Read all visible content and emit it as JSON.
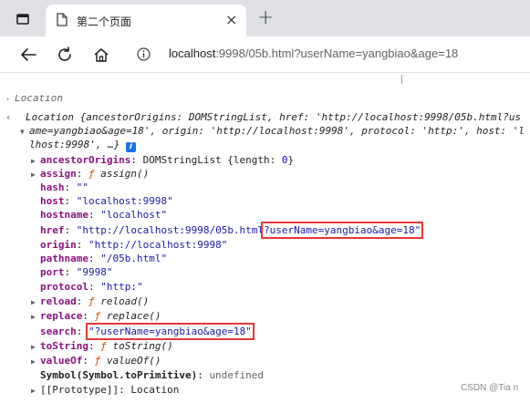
{
  "browser": {
    "tab_title": "第二个页面",
    "tab_close": "×",
    "new_tab": "+",
    "address_host": "localhost",
    "address_rest": ":9998/05b.html?userName=yangbiao&age=18"
  },
  "console": {
    "cut_line": "Location",
    "summary_prefix": "Location {",
    "summary_wrap_1": "ancestorOrigins: DOMStringList, href: 'http://localhost:9998/05b.html?us",
    "summary_wrap_2": "ame=yangbiao&age=18', origin: 'http://localhost:9998', protocol: 'http:', host: 'l",
    "summary_wrap_3": "lhost:9998', …}",
    "info": "i",
    "props": [
      {
        "key": "ancestorOrigins",
        "sep": ": ",
        "val": "DOMStringList {length: ",
        "num": "0",
        "tail": "}"
      },
      {
        "key": "assign",
        "sep": ": ",
        "f": "ƒ",
        "val": "assign()"
      },
      {
        "key": "hash",
        "sep": ": ",
        "val": "\"\""
      },
      {
        "key": "host",
        "sep": ": ",
        "val": "\"localhost:9998\""
      },
      {
        "key": "hostname",
        "sep": ": ",
        "val": "\"localhost\""
      },
      {
        "key": "href",
        "sep": ": ",
        "val_a": "\"http://localhost:9998/05b.html",
        "val_b": "?userName=yangbiao&age=18\""
      },
      {
        "key": "origin",
        "sep": ": ",
        "val": "\"http://localhost:9998\""
      },
      {
        "key": "pathname",
        "sep": ": ",
        "val": "\"/05b.html\""
      },
      {
        "key": "port",
        "sep": ": ",
        "val": "\"9998\""
      },
      {
        "key": "protocol",
        "sep": ": ",
        "val": "\"http:\""
      },
      {
        "key": "reload",
        "sep": ": ",
        "f": "ƒ",
        "val": "reload()"
      },
      {
        "key": "replace",
        "sep": ": ",
        "f": "ƒ",
        "val": "replace()"
      },
      {
        "key": "search",
        "sep": ": ",
        "val": "\"?userName=yangbiao&age=18\""
      },
      {
        "key": "toString",
        "sep": ": ",
        "f": "ƒ",
        "val": "toString()"
      },
      {
        "key": "valueOf",
        "sep": ": ",
        "f": "ƒ",
        "val": "valueOf()"
      },
      {
        "key": "Symbol(Symbol.toPrimitive)",
        "sep": ": ",
        "val": "undefined"
      },
      {
        "key": "[[Prototype]]",
        "sep": ": ",
        "val": "Location"
      }
    ]
  },
  "watermark": "CSDN @Tia n"
}
